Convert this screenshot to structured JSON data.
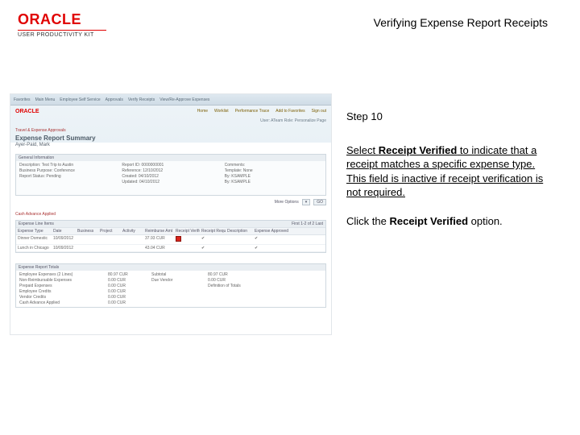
{
  "branding": {
    "logo_text": "ORACLE",
    "logo_sub": "USER PRODUCTIVITY KIT"
  },
  "doc": {
    "title": "Verifying Expense Report Receipts"
  },
  "instruction": {
    "step_label": "Step 10",
    "body_pre": "Select ",
    "body_bold": "Receipt Verified",
    "body_post": " to indicate that a receipt matches a specific expense type. This field is inactive if receipt verification is not required.",
    "action_pre": "Click the ",
    "action_bold": "Receipt Verified",
    "action_post": " option."
  },
  "screenshot": {
    "toolbar_items": [
      "Favorites",
      "Main Menu",
      "Employee Self Service",
      "Approvals",
      "Verify Receipts",
      "View/Re-Approve Expenses"
    ],
    "brand": "ORACLE",
    "tabs": [
      "Home",
      "Worklist",
      "Performance Trace",
      "Add to Favorites",
      "Sign out"
    ],
    "user_line": "User: ATeam  Role: Personalize Page",
    "crumb": "Travel & Expense Approvals",
    "title": "Expense Report Summary",
    "subtitle": "Ayer-Paid, Mark",
    "general": {
      "header": "General Information",
      "rows": [
        [
          "Description",
          "Test Trip to Austin",
          "Report ID",
          "0000000001",
          "Comments",
          ""
        ],
        [
          "Business Purpose",
          "Conference",
          "Reference",
          "12/10/2012",
          "Template",
          "None"
        ],
        [
          "Report Status",
          "Pending",
          "Created",
          "04/10/2012",
          "By",
          "KSAMPLE"
        ],
        [
          "",
          "",
          "Updated",
          "04/10/2012",
          "By",
          "KSAMPLE"
        ]
      ]
    },
    "more": {
      "label": "More Options",
      "go": "GO"
    },
    "cap_label": "Cash Advance Applied",
    "expense_section": {
      "header": "Expense Line Items",
      "header_right": "First 1-2 of 2 Last",
      "columns": [
        "Expense Type",
        "Date",
        "Business",
        "Project",
        "Activity",
        "Reimburse Amt",
        "Receipt Verified",
        "Receipt Required",
        "Description",
        "Expense Approved"
      ],
      "rows": [
        {
          "type": "Dinner Domestic",
          "date": "10/09/2012",
          "business": "",
          "project": "",
          "activity": "",
          "amt": "37.93 CUR",
          "verified_checkbox": true,
          "required": "✔",
          "desc": "",
          "approved": "✔"
        },
        {
          "type": "Lunch in Chicago",
          "date": "10/09/2012",
          "business": "",
          "project": "",
          "activity": "",
          "amt": "43.04 CUR",
          "verified_checkbox": false,
          "required": "✔",
          "desc": "",
          "approved": "✔"
        }
      ]
    },
    "totals": {
      "header": "Expense Report Totals",
      "lines": [
        [
          "Employee Expenses (2 Lines)",
          "80.97 CUR",
          "",
          "Subtotal",
          "80.97 CUR"
        ],
        [
          "Non-Reimbursable Expenses",
          "0.00 CUR",
          "",
          "Due Vendor",
          "0.00 CUR"
        ],
        [
          "Prepaid Expenses",
          "0.00 CUR",
          "",
          "",
          "Definition of Totals"
        ],
        [
          "Employee Credits",
          "0.00 CUR",
          "",
          "",
          ""
        ],
        [
          "Vendor Credits",
          "0.00 CUR",
          "",
          "",
          ""
        ],
        [
          "Cash Advance Applied",
          "0.00 CUR",
          "",
          "",
          ""
        ]
      ]
    }
  }
}
